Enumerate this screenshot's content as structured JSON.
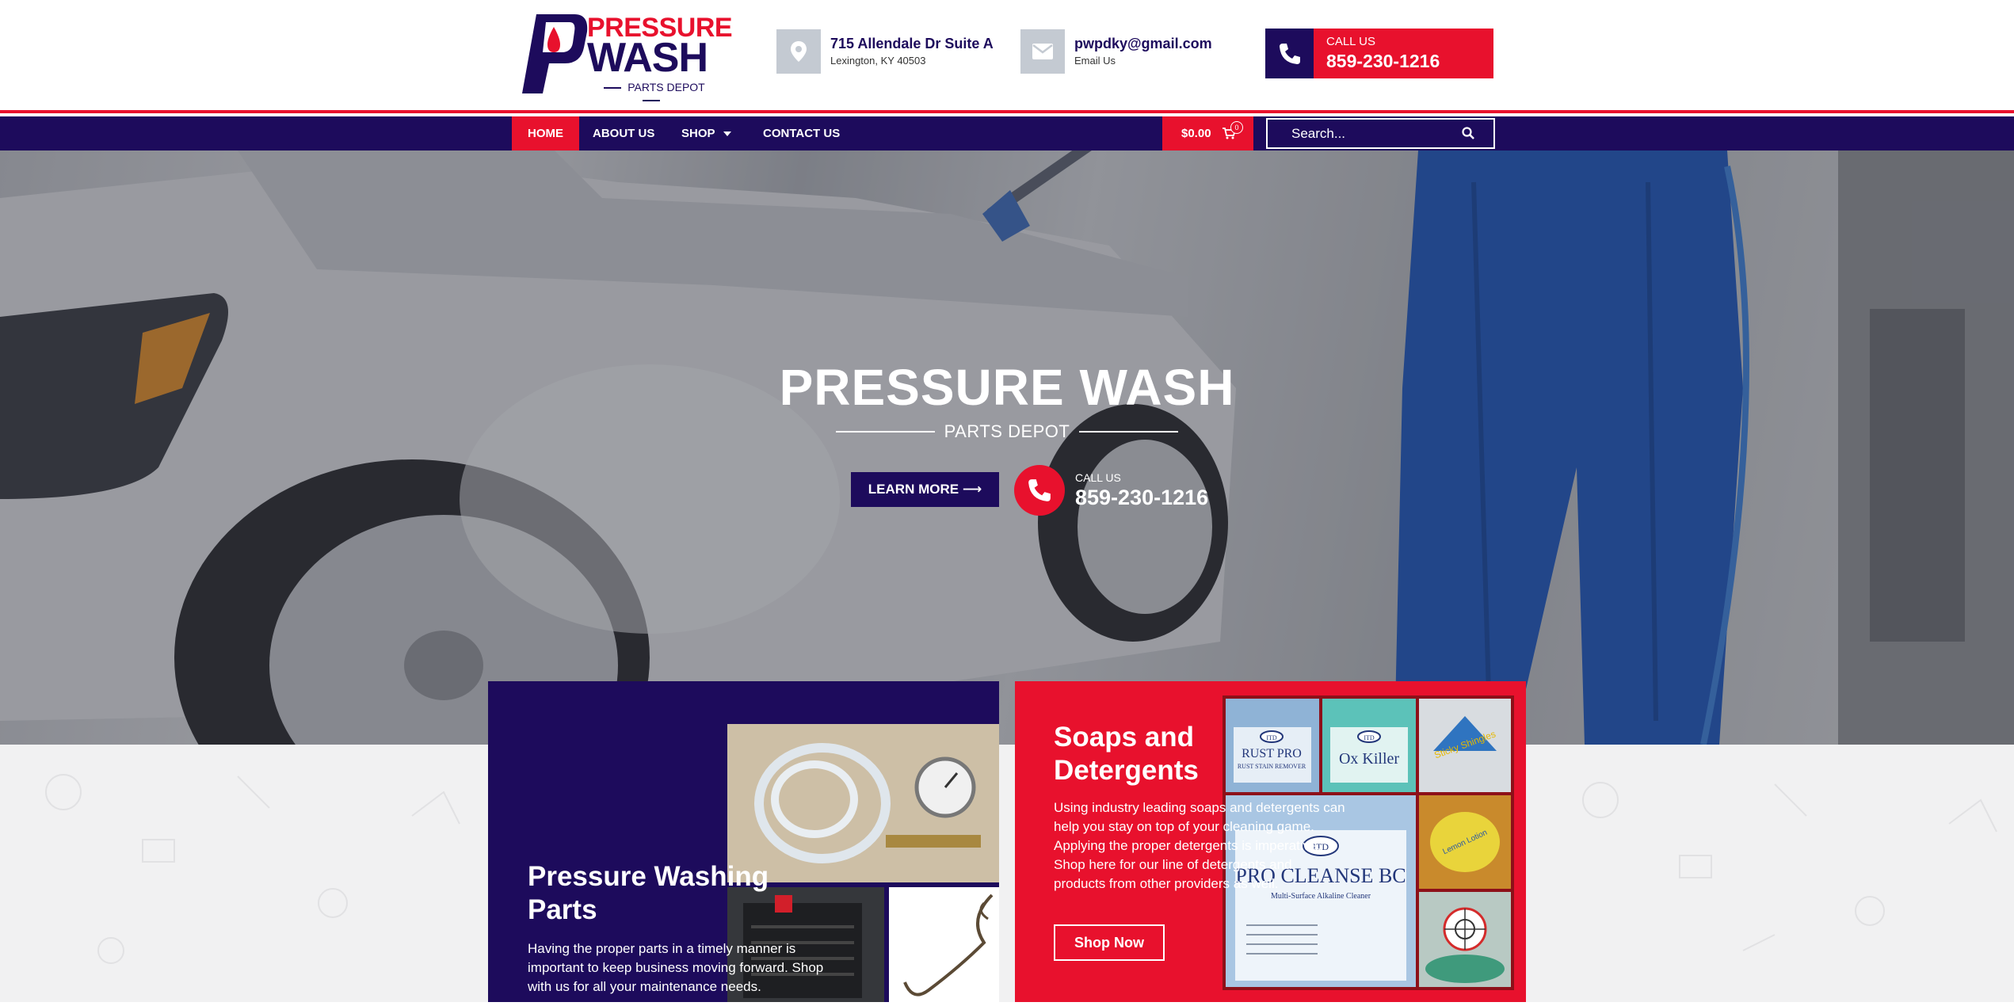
{
  "brand": {
    "logo_word1": "PRESSURE",
    "logo_word2": "WASH",
    "logo_tagline": "PARTS DEPOT",
    "primary_color": "#1d0b5c",
    "accent_color": "#e8112d"
  },
  "header": {
    "address": {
      "icon": "location-pin-icon",
      "title": "715 Allendale Dr Suite A",
      "subtitle": "Lexington, KY 40503"
    },
    "email": {
      "icon": "envelope-icon",
      "title": "pwpdky@gmail.com",
      "subtitle": "Email Us"
    },
    "call": {
      "icon": "phone-icon",
      "label": "CALL US",
      "number": "859-230-1216"
    }
  },
  "nav": {
    "items": [
      {
        "label": "HOME",
        "active": true
      },
      {
        "label": "ABOUT US",
        "active": false
      },
      {
        "label": "SHOP",
        "active": false,
        "dropdown": true
      },
      {
        "label": "CONTACT US",
        "active": false
      }
    ],
    "cart": {
      "total": "$0.00",
      "count": "0",
      "icon": "cart-icon"
    },
    "search": {
      "placeholder": "Search...",
      "icon": "search-icon"
    }
  },
  "hero": {
    "title": "PRESSURE WASH",
    "subtitle": "PARTS DEPOT",
    "learn_more": "LEARN MORE",
    "call_label": "CALL US",
    "call_number": "859-230-1216"
  },
  "cards": {
    "parts": {
      "title": "Pressure Washing Parts",
      "text": "Having the proper parts in a timely manner is important to keep business moving forward. Shop with us for all your maintenance needs."
    },
    "soaps": {
      "title": "Soaps and Detergents",
      "text": "Using industry leading soaps and detergents can help you stay on top of your cleaning game. Applying the proper detergents is imperative. Shop here for our line of detergents and products from other providers as well.",
      "button": "Shop Now",
      "product_labels": [
        "RUST PRO",
        "RUST STAIN REMOVER",
        "Ox Killer",
        "PRO CLEANSE BC",
        "Multi-Surface Alkaline Cleaner",
        "ITD",
        "Sticky Shingles",
        "Lemon Lotion"
      ]
    }
  }
}
